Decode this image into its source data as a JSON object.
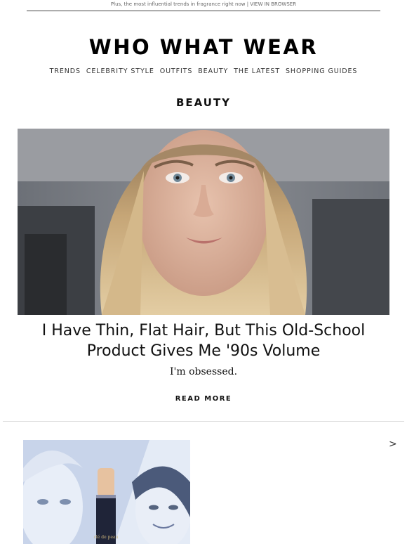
{
  "preheader": {
    "text": "Plus, the most influential trends in fragrance right now",
    "separator": "|",
    "view_in_browser": "VIEW IN BROWSER"
  },
  "brand": {
    "logo": "WHO WHAT WEAR"
  },
  "nav": {
    "items": [
      {
        "label": "TRENDS"
      },
      {
        "label": "CELEBRITY STYLE"
      },
      {
        "label": "OUTFITS"
      },
      {
        "label": "BEAUTY"
      },
      {
        "label": "THE LATEST"
      },
      {
        "label": "SHOPPING GUIDES"
      }
    ]
  },
  "section": {
    "title": "BEAUTY"
  },
  "article": {
    "headline_line1": "I Have Thin, Flat Hair, But This Old-School",
    "headline_line2": "Product Gives Me '90s Volume",
    "dek": "I'm obsessed.",
    "cta": "READ MORE"
  },
  "carousel": {
    "next_symbol": ">",
    "product_brand_text": "clé de peau"
  },
  "colors": {
    "text": "#111111",
    "preheader": "#666666",
    "divider": "#dddddd",
    "carousel_tint": "#c8d4ea"
  }
}
